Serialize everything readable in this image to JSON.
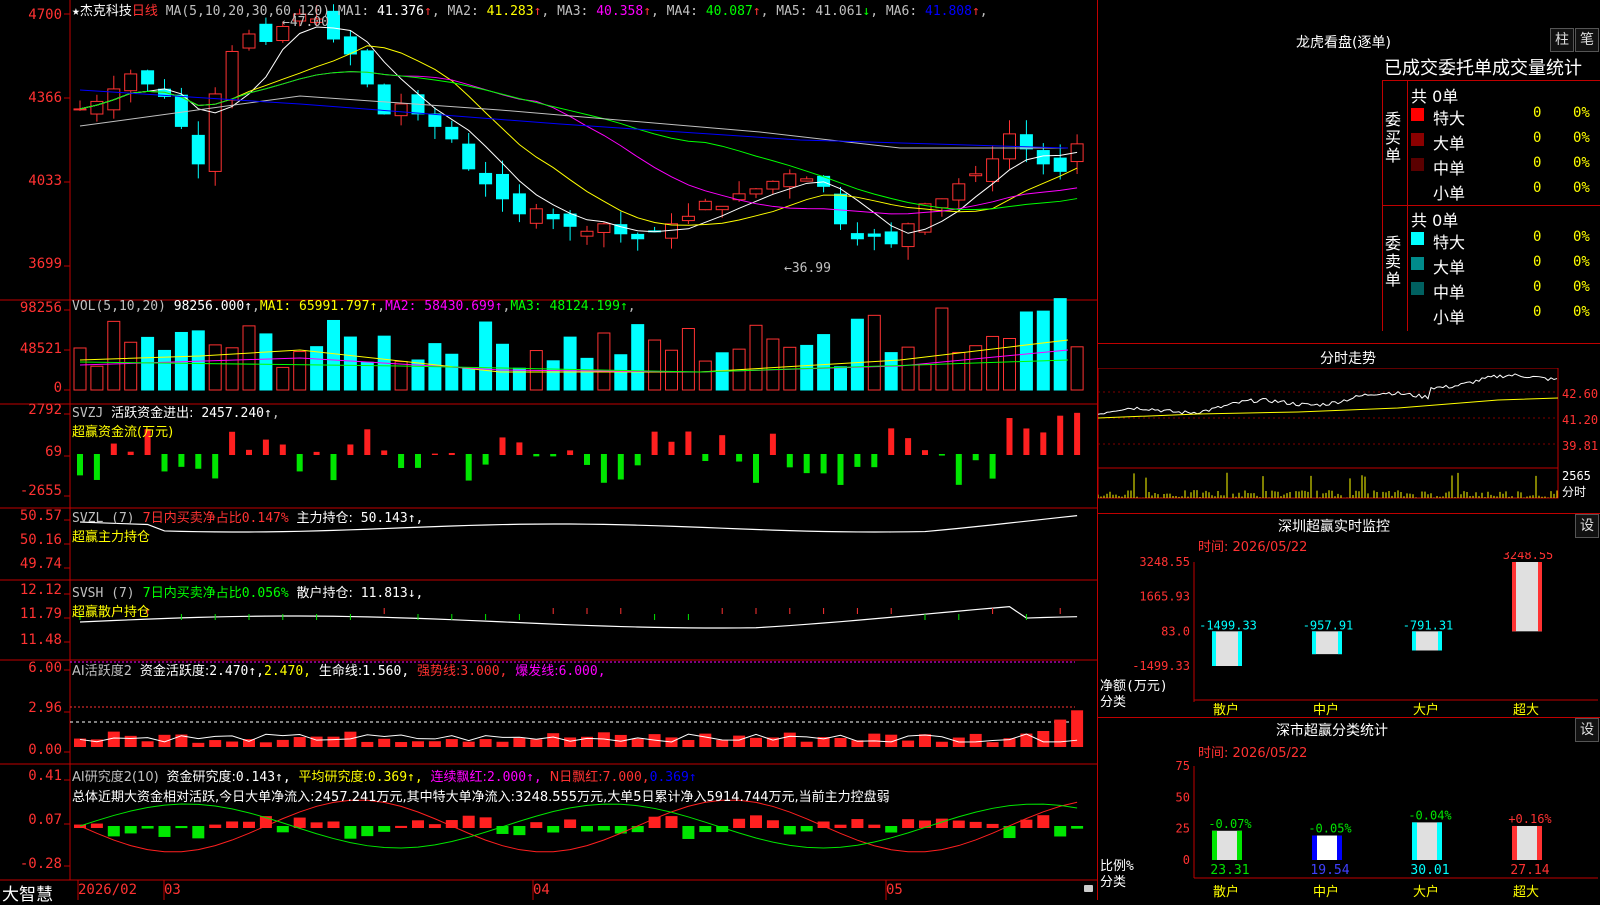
{
  "stock": {
    "star": "★",
    "name": "杰克科技",
    "period": "日线"
  },
  "price_panel": {
    "ma_header": "MA(5,10,20,30,60,120)",
    "ma": [
      {
        "label": "MA1:",
        "value": "41.376",
        "arrow": "↑",
        "color": "#ffffff"
      },
      {
        "label": "MA2:",
        "value": "41.283",
        "arrow": "↑",
        "color": "#ffff00"
      },
      {
        "label": "MA3:",
        "value": "40.358",
        "arrow": "↑",
        "color": "#ff00ff"
      },
      {
        "label": "MA4:",
        "value": "40.087",
        "arrow": "↑",
        "color": "#00ff00"
      },
      {
        "label": "MA5:",
        "value": "41.061",
        "arrow": "↓",
        "color": "#c0c0c0"
      },
      {
        "label": "MA6:",
        "value": "41.808",
        "arrow": "↑",
        "color": "#0000ff"
      }
    ],
    "axis": [
      "4700",
      "4366",
      "4033",
      "3699"
    ],
    "high_label": "47.00",
    "low_label": "36.99"
  },
  "vol_panel": {
    "title": "VOL(5,10,20)",
    "value": "98256.000↑",
    "ma": [
      {
        "label": "MA1:",
        "value": "65991.797↑",
        "color": "#ffff00"
      },
      {
        "label": "MA2:",
        "value": "58430.699↑",
        "color": "#ff00ff"
      },
      {
        "label": "MA3:",
        "value": "48124.199↑",
        "color": "#00ff00"
      }
    ],
    "axis": [
      "98256",
      "48521",
      "0"
    ]
  },
  "svzj_panel": {
    "title": "SVZJ",
    "label": "活跃资金进出:",
    "value": "2457.240↑",
    "subtitle": "超赢资金流(万元)",
    "axis": [
      "2792",
      "69",
      "-2655"
    ]
  },
  "svzl_panel": {
    "title": "SVZL (7)",
    "label1": "7日内买卖净占比",
    "value1": "0.147%",
    "label2": "主力持仓:",
    "value2": "50.143↑,",
    "subtitle": "超赢主力持仓",
    "axis": [
      "50.57",
      "50.16",
      "49.74"
    ]
  },
  "svsh_panel": {
    "title": "SVSH (7)",
    "label1": "7日内买卖净占比",
    "value1": "0.056%",
    "label2": "散户持仓:",
    "value2": "11.813↓,",
    "subtitle": "超赢散户持仓",
    "axis": [
      "12.12",
      "11.79",
      "11.48"
    ]
  },
  "ai1_panel": {
    "title": "AI活跃度2",
    "label1": "资金活跃度:",
    "value1": "2.470↑,",
    "value1b": "2.470,",
    "label2": "生命线:",
    "value2": "1.560,",
    "label3": "强势线:",
    "value3": "3.000,",
    "label4": "爆发线:",
    "value4": "6.000,",
    "axis": [
      "6.00",
      "2.96",
      "0.00"
    ]
  },
  "ai2_panel": {
    "title": "AI研究度2(10)",
    "label1": "资金研究度:",
    "value1": "0.143↑,",
    "label2": "平均研究度:",
    "value2": "0.369↑,",
    "label3": "连续飘红:",
    "value3": "2.000↑,",
    "label4": "N日飘红:",
    "value4": "7.000,",
    "value5": "0.369↑",
    "summary": "总体近期大资金相对活跃,今日大单净流入:2457.241万元,其中特大单净流入:3248.555万元,大单5日累计净入5914.744万元,当前主力控盘弱",
    "axis": [
      "0.41",
      "0.07",
      "-0.28"
    ]
  },
  "date_axis": {
    "brand": "大智慧",
    "labels": [
      "2026/02",
      "03",
      "04",
      "05"
    ]
  },
  "dragon": {
    "title": "龙虎看盘(逐单)",
    "btn1": "柱",
    "btn2": "笔",
    "header": "已成交委托单成交量统计",
    "buy": {
      "side": "委买单",
      "total": "共 0单",
      "rows": [
        {
          "name": "特大",
          "qty": "0",
          "pct": "0%",
          "color": "#ff0000"
        },
        {
          "name": "大单",
          "qty": "0",
          "pct": "0%",
          "color": "#8b0000"
        },
        {
          "name": "中单",
          "qty": "0",
          "pct": "0%",
          "color": "#5a0000"
        },
        {
          "name": "小单",
          "qty": "0",
          "pct": "0%",
          "color": "#000000"
        }
      ]
    },
    "sell": {
      "side": "委卖单",
      "total": "共 0单",
      "rows": [
        {
          "name": "特大",
          "qty": "0",
          "pct": "0%",
          "color": "#00ffff"
        },
        {
          "name": "大单",
          "qty": "0",
          "pct": "0%",
          "color": "#008b8b"
        },
        {
          "name": "中单",
          "qty": "0",
          "pct": "0%",
          "color": "#006060"
        },
        {
          "name": "小单",
          "qty": "0",
          "pct": "0%",
          "color": "#000000"
        }
      ]
    }
  },
  "intraday": {
    "title": "分时走势",
    "axis": [
      "42.60",
      "41.20",
      "39.81"
    ],
    "vol_axis": [
      "2565",
      "分时"
    ]
  },
  "sz_monitor": {
    "title": "深圳超赢实时监控",
    "btn": "设",
    "time": "时间: 2026/05/22",
    "axis": [
      "3248.55",
      "1665.93",
      "83.0",
      "-1499.33"
    ],
    "ylabel": "净额(万元)",
    "xlabel": "分类",
    "bars": [
      {
        "cat": "散户",
        "value": "-1499.33"
      },
      {
        "cat": "中户",
        "value": "-957.91"
      },
      {
        "cat": "大户",
        "value": "-791.31"
      },
      {
        "cat": "超大",
        "value": "3248.55"
      }
    ]
  },
  "sz_class": {
    "title": "深市超赢分类统计",
    "btn": "设",
    "time": "时间: 2026/05/22",
    "axis": [
      "75",
      "50",
      "25",
      "0"
    ],
    "ylabel": "比例%",
    "xlabel": "分类",
    "bars": [
      {
        "cat": "散户",
        "pct": "23.31",
        "chg": "-0.07%"
      },
      {
        "cat": "中户",
        "pct": "19.54",
        "chg": "-0.05%"
      },
      {
        "cat": "大户",
        "pct": "30.01",
        "chg": "-0.04%"
      },
      {
        "cat": "超大",
        "pct": "27.14",
        "chg": "+0.16%"
      }
    ]
  },
  "chart_data": [
    {
      "type": "bar",
      "title": "深圳超赢实时监控",
      "categories": [
        "散户",
        "中户",
        "大户",
        "超大"
      ],
      "values": [
        -1499.33,
        -957.91,
        -791.31,
        3248.55
      ],
      "ylabel": "净额(万元)",
      "xlabel": "分类",
      "ylim": [
        -1499.33,
        3248.55
      ]
    },
    {
      "type": "bar",
      "title": "深市超赢分类统计",
      "categories": [
        "散户",
        "中户",
        "大户",
        "超大"
      ],
      "values": [
        23.31,
        19.54,
        30.01,
        27.14
      ],
      "ylabel": "比例%",
      "xlabel": "分类",
      "ylim": [
        0,
        75
      ]
    }
  ]
}
